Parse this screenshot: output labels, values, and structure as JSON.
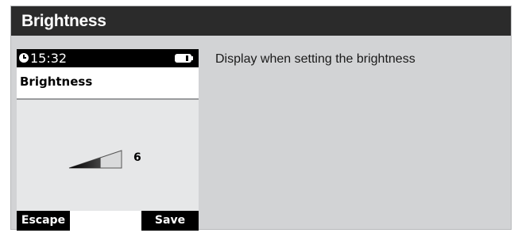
{
  "panel": {
    "title": "Brightness",
    "description": "Display when setting the brightness"
  },
  "device": {
    "status": {
      "time": "15:32",
      "clock_icon": "clock-icon",
      "battery_icon": "battery-icon"
    },
    "screen_title": "Brightness",
    "brightness": {
      "value": "6",
      "level_fraction": 0.6
    },
    "softkeys": {
      "left_label": "Escape",
      "right_label": "Save"
    }
  },
  "colors": {
    "panel_header": "#2b2b2b",
    "panel_background": "#d2d3d5",
    "device_bar": "#000000"
  }
}
